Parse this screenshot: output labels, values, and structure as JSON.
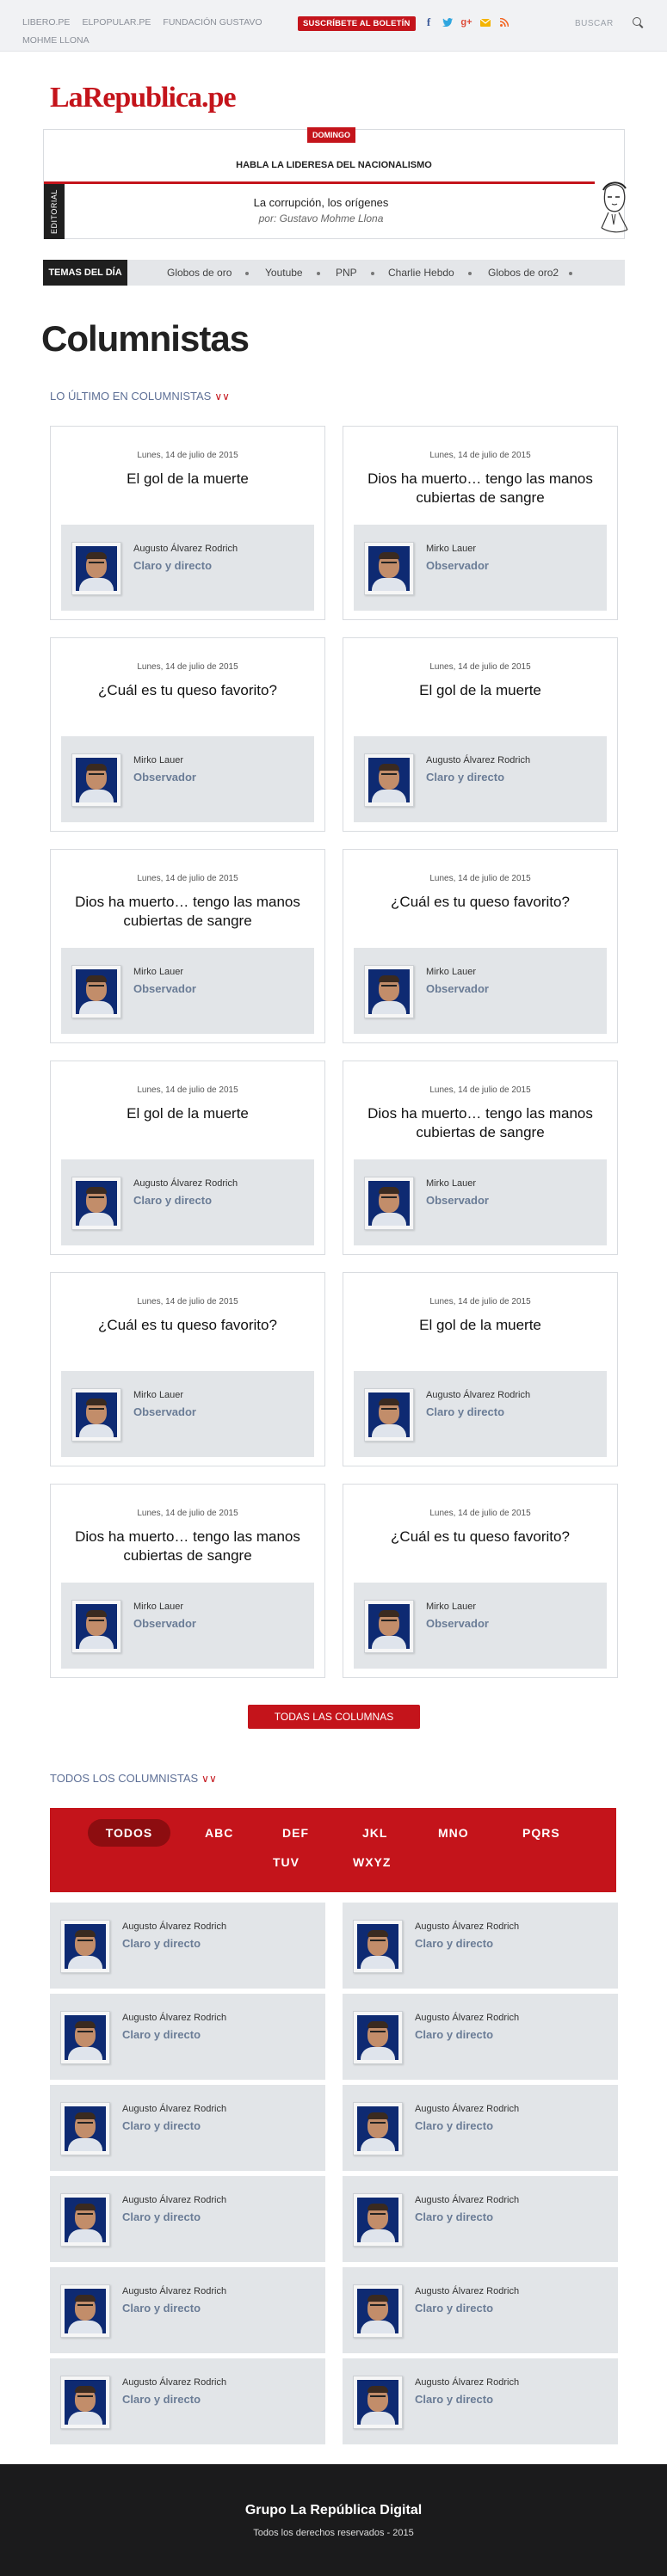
{
  "topbar": {
    "links": [
      "LIBERO.PE",
      "ELPOPULAR.PE",
      "FUNDACIÓN GUSTAVO MOHME LLONA"
    ],
    "subscribe_label": "SUSCRÍBETE AL BOLETÍN",
    "social_icons": [
      "facebook-icon",
      "twitter-icon",
      "googleplus-icon",
      "email-icon",
      "rss-icon"
    ],
    "search_label": "BUSCAR"
  },
  "logo": "LaRepublica.pe",
  "editorial": {
    "day": "DOMINGO",
    "headline": "HABLA LA LIDERESA DEL NACIONALISMO",
    "label": "EDITORIAL",
    "title": "La corrupción, los orígenes",
    "author": "por: Gustavo Mohme Llona"
  },
  "temas": {
    "label": "TEMAS DEL DÍA",
    "items": [
      "Globos de oro",
      "Youtube",
      "PNP",
      "Charlie Hebdo",
      "Globos de oro2"
    ]
  },
  "page_title": "Columnistas",
  "latest": {
    "heading": "LO ÚLTIMO EN COLUMNISTAS",
    "cards": [
      {
        "date": "Lunes, 14 de julio de 2015",
        "title": "El gol de la muerte",
        "author": "Augusto Álvarez Rodrich",
        "column": "Claro y directo"
      },
      {
        "date": "Lunes, 14 de julio de 2015",
        "title": "Dios ha muerto… tengo las manos cubiertas de sangre",
        "author": "Mirko Lauer",
        "column": "Observador"
      },
      {
        "date": "Lunes, 14 de julio de 2015",
        "title": "¿Cuál es tu queso favorito?",
        "author": "Mirko Lauer",
        "column": "Observador"
      },
      {
        "date": "Lunes, 14 de julio de 2015",
        "title": "El gol de la muerte",
        "author": "Augusto Álvarez Rodrich",
        "column": "Claro y directo"
      },
      {
        "date": "Lunes, 14 de julio de 2015",
        "title": "Dios ha muerto… tengo las manos cubiertas de sangre",
        "author": "Mirko Lauer",
        "column": "Observador"
      },
      {
        "date": "Lunes, 14 de julio de 2015",
        "title": "¿Cuál es tu queso favorito?",
        "author": "Mirko Lauer",
        "column": "Observador"
      },
      {
        "date": "Lunes, 14 de julio de 2015",
        "title": "El gol de la muerte",
        "author": "Augusto Álvarez Rodrich",
        "column": "Claro y directo"
      },
      {
        "date": "Lunes, 14 de julio de 2015",
        "title": "Dios ha muerto… tengo las manos cubiertas de sangre",
        "author": "Mirko Lauer",
        "column": "Observador"
      },
      {
        "date": "Lunes, 14 de julio de 2015",
        "title": "¿Cuál es tu queso favorito?",
        "author": "Mirko Lauer",
        "column": "Observador"
      },
      {
        "date": "Lunes, 14 de julio de 2015",
        "title": "El gol de la muerte",
        "author": "Augusto Álvarez Rodrich",
        "column": "Claro y directo"
      },
      {
        "date": "Lunes, 14 de julio de 2015",
        "title": "Dios ha muerto… tengo las manos cubiertas de sangre",
        "author": "Mirko Lauer",
        "column": "Observador"
      },
      {
        "date": "Lunes, 14 de julio de 2015",
        "title": "¿Cuál es tu queso favorito?",
        "author": "Mirko Lauer",
        "column": "Observador"
      }
    ]
  },
  "all_columns_button": "TODAS LAS COLUMNAS",
  "all": {
    "heading": "TODOS LOS COLUMNISTAS",
    "filters": [
      "TODOS",
      "ABC",
      "DEF",
      "JKL",
      "MNO",
      "PQRS",
      "TUV",
      "WXYZ"
    ],
    "active_filter": "TODOS",
    "columnists": [
      {
        "author": "Augusto Álvarez Rodrich",
        "column": "Claro y directo"
      },
      {
        "author": "Augusto Álvarez Rodrich",
        "column": "Claro y directo"
      },
      {
        "author": "Augusto Álvarez Rodrich",
        "column": "Claro y directo"
      },
      {
        "author": "Augusto Álvarez Rodrich",
        "column": "Claro y directo"
      },
      {
        "author": "Augusto Álvarez Rodrich",
        "column": "Claro y directo"
      },
      {
        "author": "Augusto Álvarez Rodrich",
        "column": "Claro y directo"
      },
      {
        "author": "Augusto Álvarez Rodrich",
        "column": "Claro y directo"
      },
      {
        "author": "Augusto Álvarez Rodrich",
        "column": "Claro y directo"
      },
      {
        "author": "Augusto Álvarez Rodrich",
        "column": "Claro y directo"
      },
      {
        "author": "Augusto Álvarez Rodrich",
        "column": "Claro y directo"
      },
      {
        "author": "Augusto Álvarez Rodrich",
        "column": "Claro y directo"
      },
      {
        "author": "Augusto Álvarez Rodrich",
        "column": "Claro y directo"
      }
    ]
  },
  "footer": {
    "title": "Grupo La República Digital",
    "rights": "Todos los derechos reservados - 2015"
  },
  "colors": {
    "brand_red": "#c4141b",
    "dark": "#1b1b1c",
    "author_box": "#e2e5e8",
    "column_name": "#6a7c96",
    "heading_blue": "#5d6f96"
  }
}
